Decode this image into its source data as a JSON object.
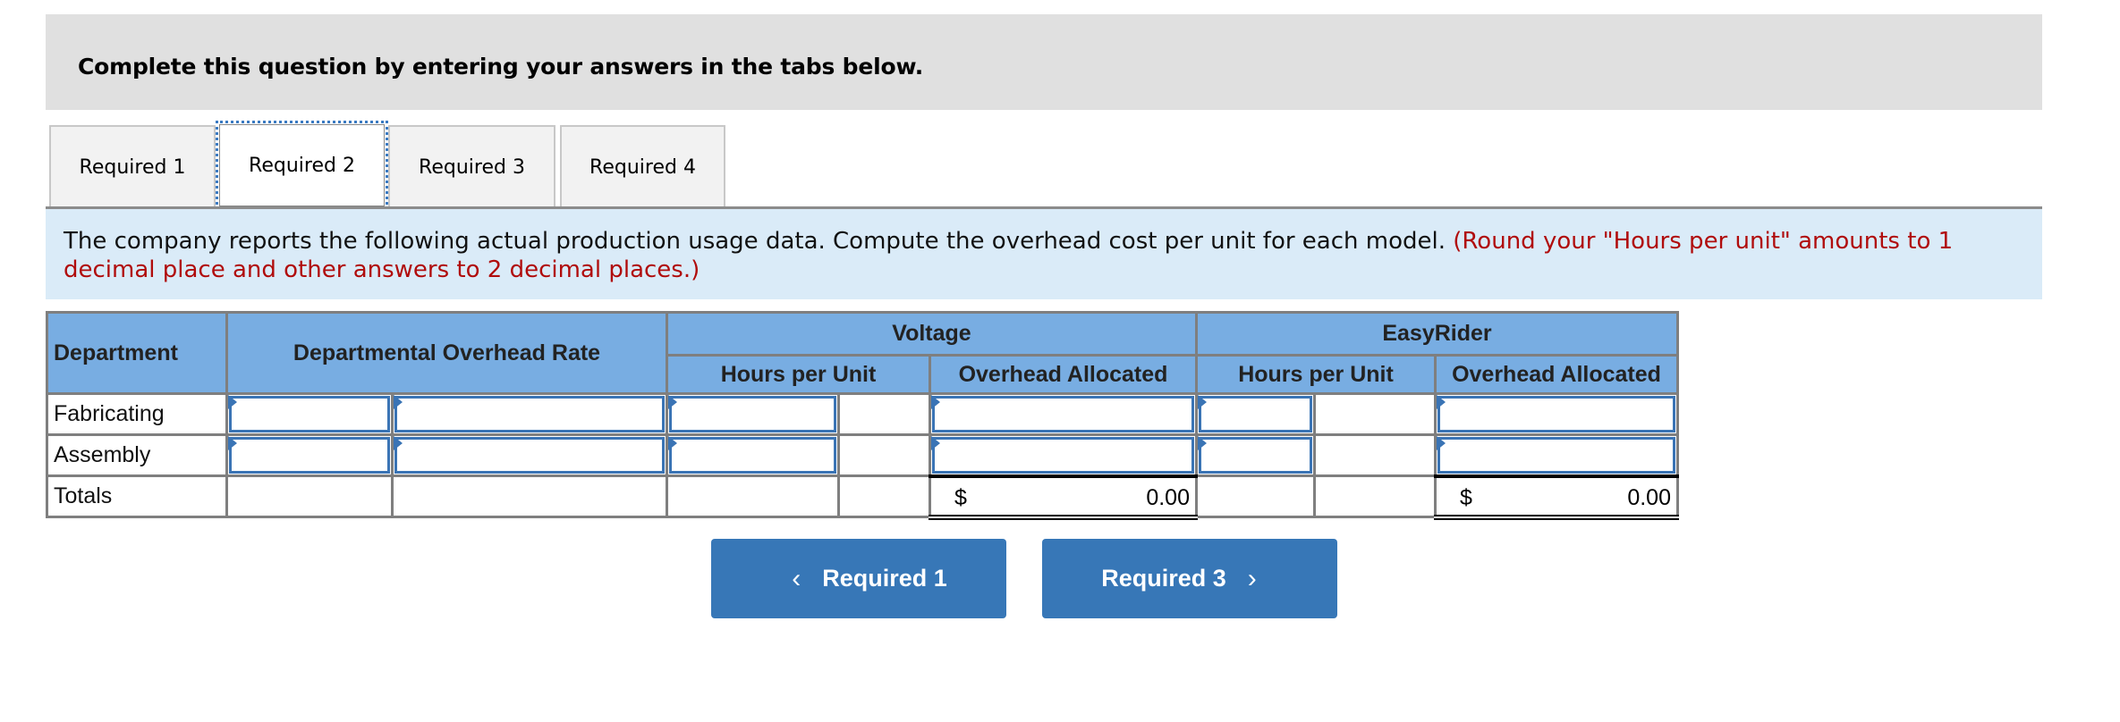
{
  "header": {
    "title": "Complete this question by entering your answers in the tabs below."
  },
  "tabs": [
    {
      "label": "Required 1",
      "active": false
    },
    {
      "label": "Required 2",
      "active": true
    },
    {
      "label": "Required 3",
      "active": false
    },
    {
      "label": "Required 4",
      "active": false
    }
  ],
  "instructions": {
    "text": "The company reports the following actual production usage data. Compute the overhead cost per unit for each model.",
    "note": "(Round your \"Hours per unit\" amounts to 1 decimal place and other answers to 2 decimal places.)"
  },
  "table": {
    "headers": {
      "department": "Department",
      "rate": "Departmental Overhead Rate",
      "voltage": "Voltage",
      "easyrider": "EasyRider",
      "hours_per_unit": "Hours per Unit",
      "overhead_allocated": "Overhead Allocated"
    },
    "rows": [
      {
        "department": "Fabricating",
        "rate_a": "",
        "rate_b": "",
        "v_hours": "",
        "v_overhead": "",
        "e_hours": "",
        "e_overhead": ""
      },
      {
        "department": "Assembly",
        "rate_a": "",
        "rate_b": "",
        "v_hours": "",
        "v_overhead": "",
        "e_hours": "",
        "e_overhead": ""
      }
    ],
    "totals": {
      "label": "Totals",
      "voltage_currency": "$",
      "voltage_amount": "0.00",
      "easyrider_currency": "$",
      "easyrider_amount": "0.00"
    }
  },
  "nav": {
    "prev_label": "Required 1",
    "next_label": "Required 3",
    "prev_icon": "‹",
    "next_icon": "›"
  },
  "colors": {
    "header_bg": "#e0e0e0",
    "instr_bg": "#daebf8",
    "table_header_bg": "#78ade2",
    "input_border": "#3a74b5",
    "button_bg": "#3777b7",
    "note_red": "#b00c0c"
  }
}
